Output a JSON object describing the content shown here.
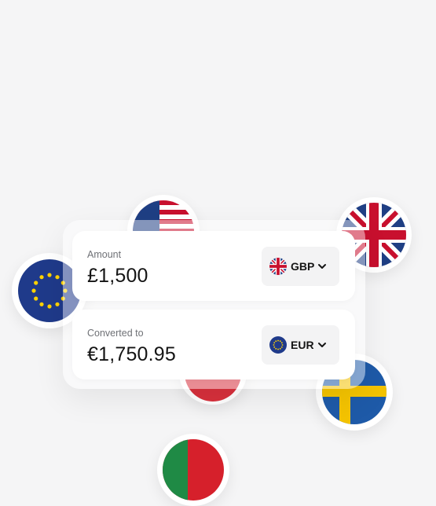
{
  "converter": {
    "amount_card": {
      "label": "Amount",
      "value": "£1,500",
      "currency": "GBP",
      "flag_icon": "uk-flag-icon"
    },
    "converted_card": {
      "label": "Converted to",
      "value": "€1,750.95",
      "currency": "EUR",
      "flag_icon": "eu-flag-icon"
    }
  },
  "decorative_flags": [
    "us-flag-icon",
    "uk-flag-icon",
    "eu-flag-icon",
    "sweden-flag-icon",
    "red-flag-icon",
    "portugal-flag-icon"
  ],
  "colors": {
    "background": "#f5f5f6",
    "card": "#ffffff",
    "selector_bg": "#f3f3f4",
    "text_primary": "#141414",
    "text_secondary": "#6f7176"
  }
}
